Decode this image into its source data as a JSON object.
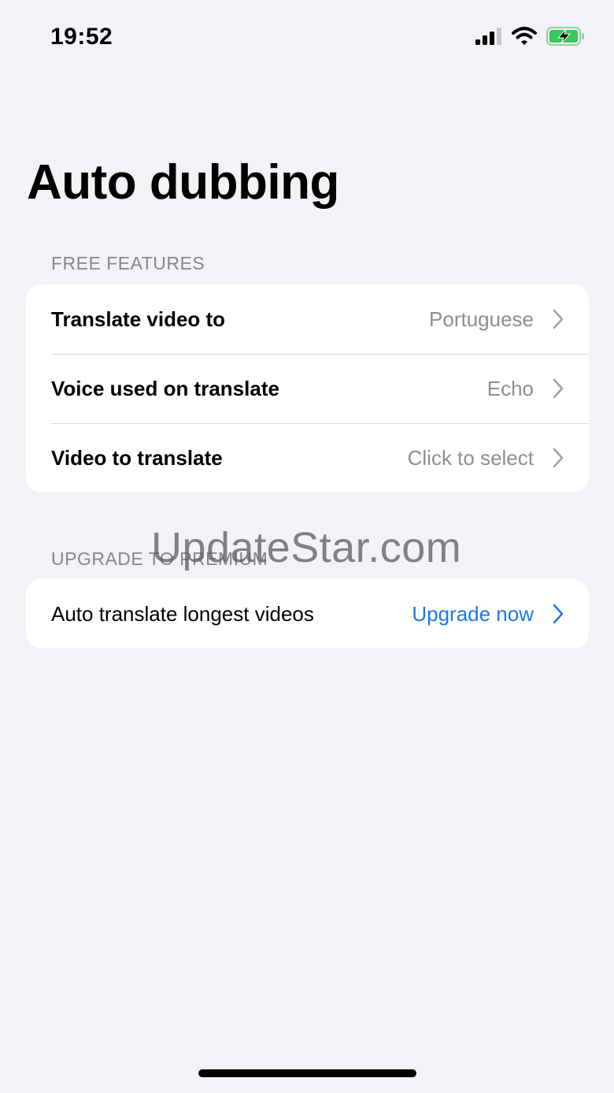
{
  "status_bar": {
    "time": "19:52",
    "icons": [
      "signal-icon",
      "wifi-icon",
      "battery-charging-icon"
    ]
  },
  "page": {
    "title": "Auto dubbing"
  },
  "free_features": {
    "header": "FREE FEATURES",
    "rows": [
      {
        "label": "Translate video to",
        "value": "Portuguese"
      },
      {
        "label": "Voice used on translate",
        "value": "Echo"
      },
      {
        "label": "Video to translate",
        "value": "Click to select"
      }
    ]
  },
  "premium": {
    "header": "UPGRADE TO PREMIUM",
    "rows": [
      {
        "label": "Auto translate longest videos",
        "value": "Upgrade now"
      }
    ]
  },
  "watermark": "UpdateStar.com",
  "colors": {
    "background": "#f2f2f7",
    "card": "#ffffff",
    "secondary_text": "#8e8e93",
    "link": "#1a7ae6",
    "battery_green": "#34c759"
  }
}
